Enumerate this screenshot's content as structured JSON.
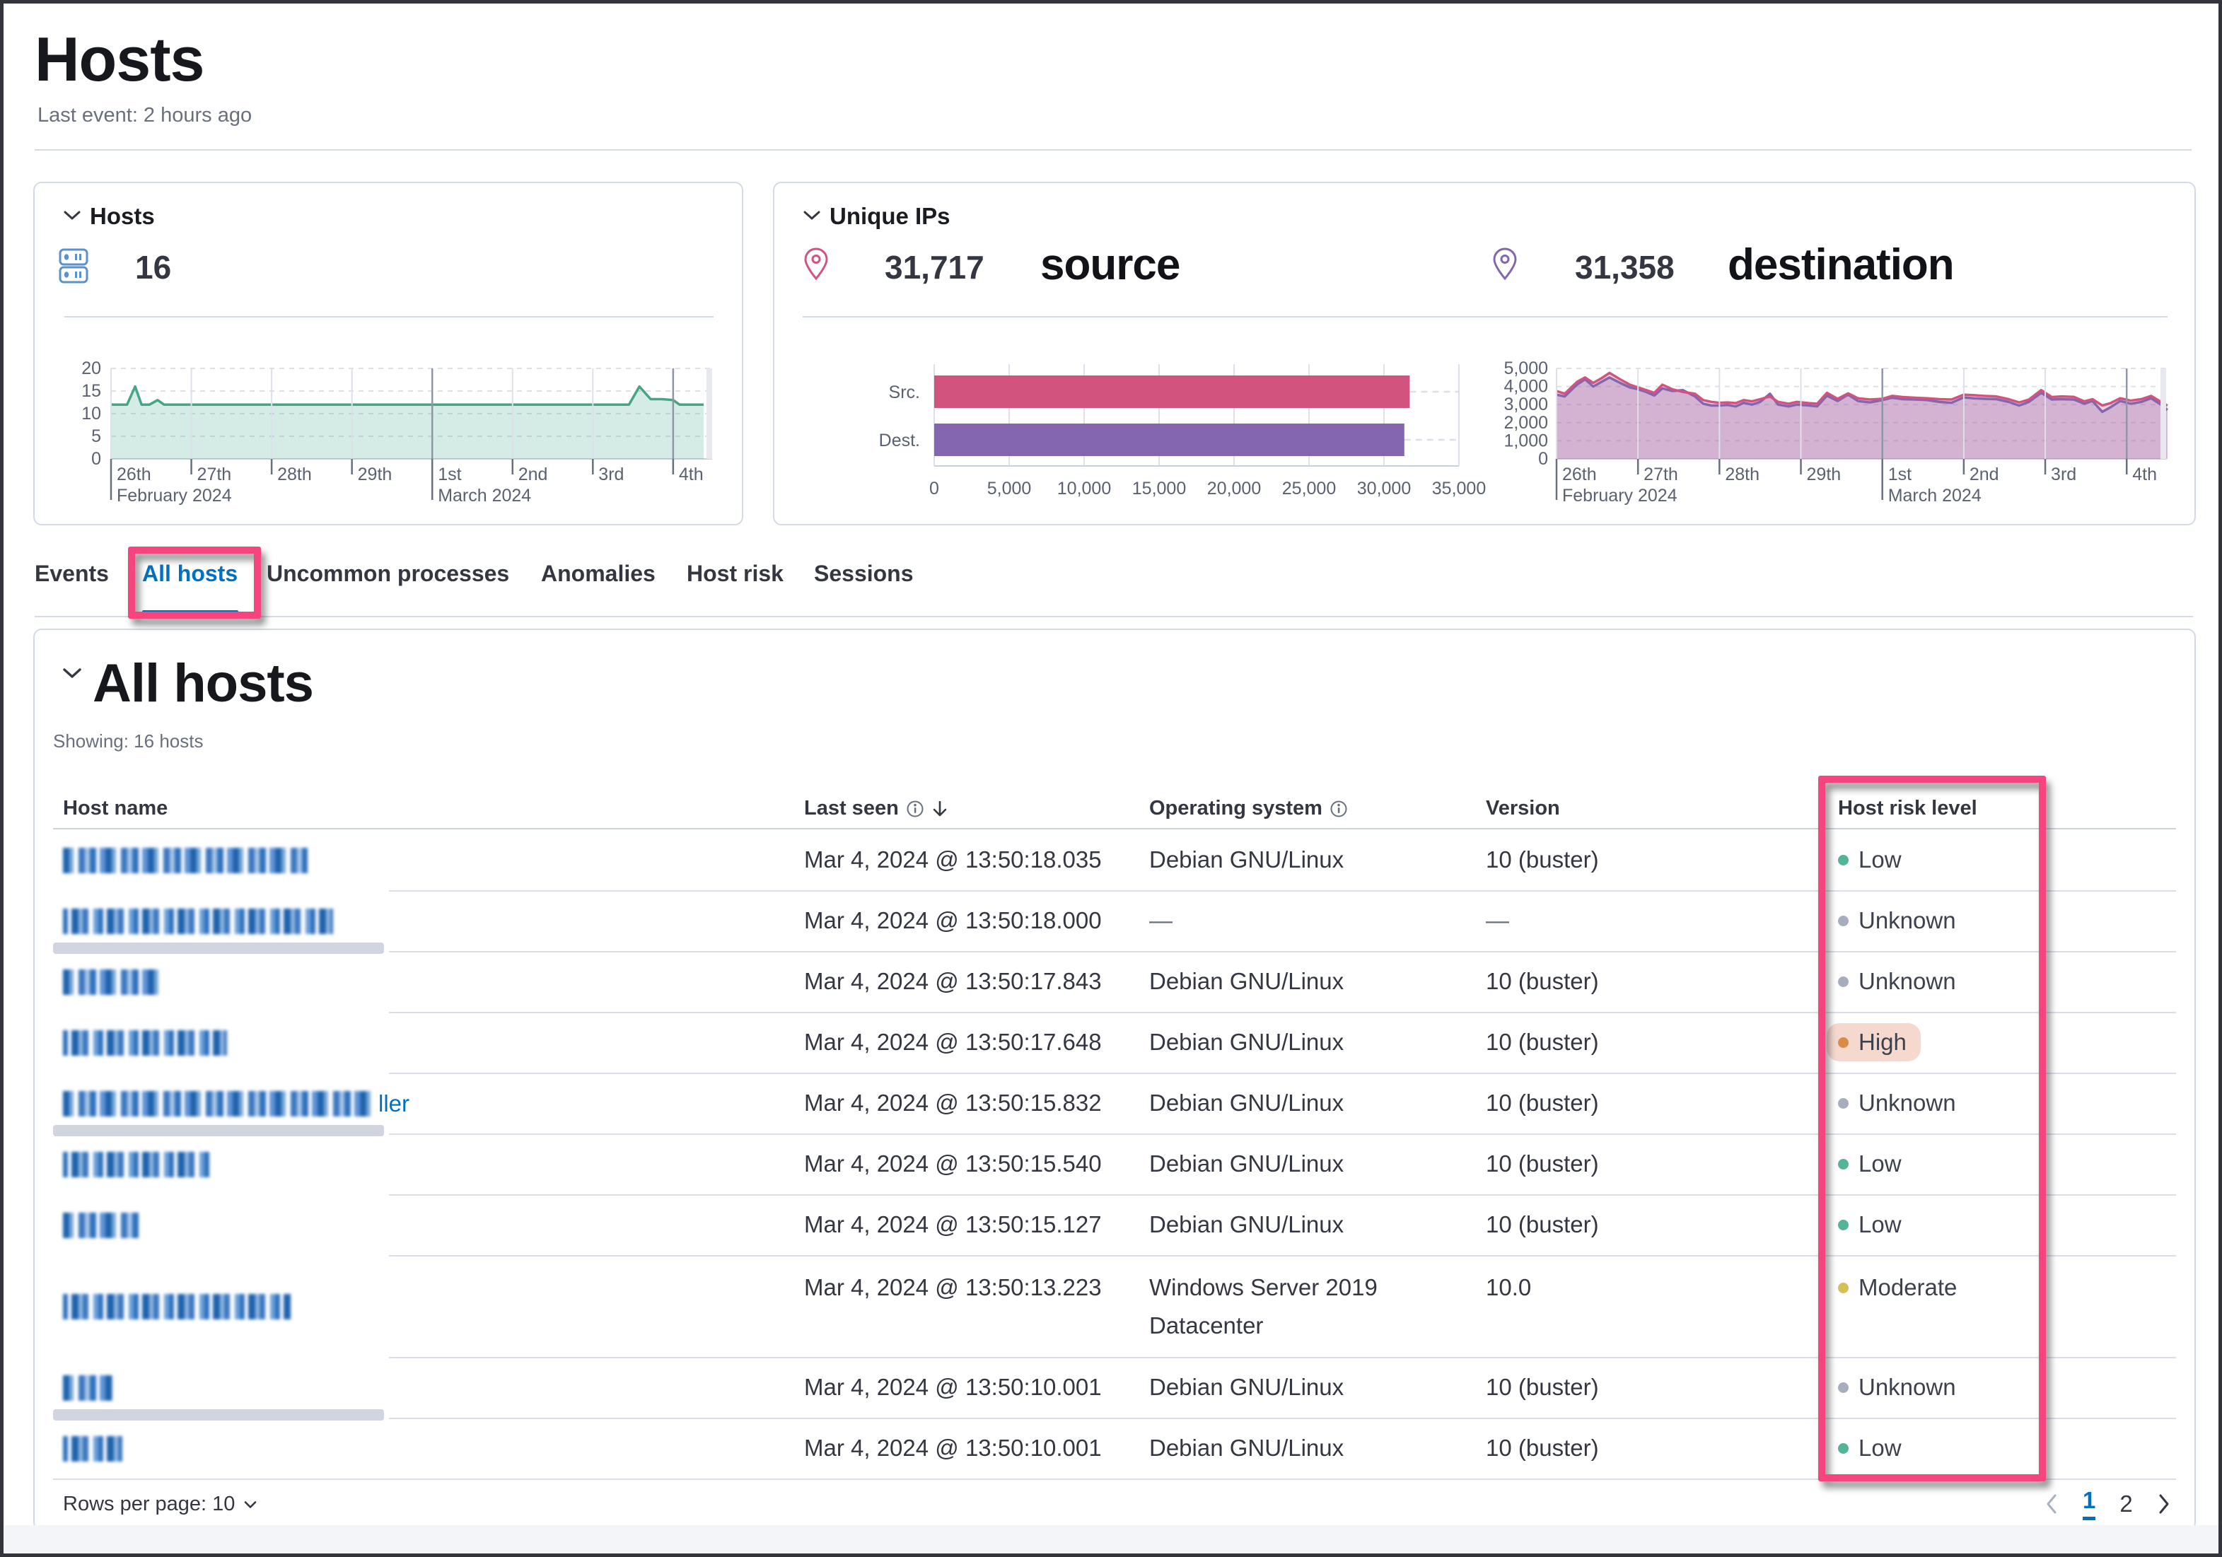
{
  "page": {
    "title": "Hosts",
    "last_event": "Last event: 2 hours ago"
  },
  "hosts_panel": {
    "title": "Hosts",
    "count": "16"
  },
  "unique_ips_panel": {
    "title": "Unique IPs",
    "source": {
      "value": "31,717",
      "label": "source"
    },
    "destination": {
      "value": "31,358",
      "label": "destination"
    },
    "bar_labels": {
      "src": "Src.",
      "dest": "Dest."
    }
  },
  "tabs": [
    {
      "label": "Events",
      "active": false
    },
    {
      "label": "All hosts",
      "active": true
    },
    {
      "label": "Uncommon processes",
      "active": false
    },
    {
      "label": "Anomalies",
      "active": false
    },
    {
      "label": "Host risk",
      "active": false
    },
    {
      "label": "Sessions",
      "active": false
    }
  ],
  "all_hosts": {
    "title": "All hosts",
    "showing": "Showing: 16 hosts",
    "columns": [
      {
        "label": "Host name",
        "info": false,
        "sorted": false
      },
      {
        "label": "Last seen",
        "info": true,
        "sorted": true
      },
      {
        "label": "Operating system",
        "info": true,
        "sorted": false
      },
      {
        "label": "Version",
        "info": false,
        "sorted": false
      },
      {
        "label": "Host risk level",
        "info": false,
        "sorted": false
      }
    ],
    "rows": [
      {
        "censor_width": 346,
        "name_suffix": "",
        "last_seen": "Mar 4, 2024 @ 13:50:18.035",
        "os": "Debian GNU/Linux",
        "os_line2": "",
        "version": "10 (buster)",
        "risk": "Low",
        "gray_bar": false
      },
      {
        "censor_width": 382,
        "name_suffix": "",
        "last_seen": "Mar 4, 2024 @ 13:50:18.000",
        "os": "—",
        "os_line2": "",
        "version": "—",
        "risk": "Unknown",
        "gray_bar": true
      },
      {
        "censor_width": 140,
        "name_suffix": "",
        "last_seen": "Mar 4, 2024 @ 13:50:17.843",
        "os": "Debian GNU/Linux",
        "os_line2": "",
        "version": "10 (buster)",
        "risk": "Unknown",
        "gray_bar": false
      },
      {
        "censor_width": 232,
        "name_suffix": "",
        "last_seen": "Mar 4, 2024 @ 13:50:17.648",
        "os": "Debian GNU/Linux",
        "os_line2": "",
        "version": "10 (buster)",
        "risk": "High",
        "gray_bar": false
      },
      {
        "censor_width": 442,
        "name_suffix": "ller",
        "last_seen": "Mar 4, 2024 @ 13:50:15.832",
        "os": "Debian GNU/Linux",
        "os_line2": "",
        "version": "10 (buster)",
        "risk": "Unknown",
        "gray_bar": true
      },
      {
        "censor_width": 208,
        "name_suffix": "",
        "last_seen": "Mar 4, 2024 @ 13:50:15.540",
        "os": "Debian GNU/Linux",
        "os_line2": "",
        "version": "10 (buster)",
        "risk": "Low",
        "gray_bar": false
      },
      {
        "censor_width": 108,
        "name_suffix": "",
        "last_seen": "Mar 4, 2024 @ 13:50:15.127",
        "os": "Debian GNU/Linux",
        "os_line2": "",
        "version": "10 (buster)",
        "risk": "Low",
        "gray_bar": false
      },
      {
        "censor_width": 322,
        "name_suffix": "",
        "last_seen": "Mar 4, 2024 @ 13:50:13.223",
        "os": "Windows Server 2019",
        "os_line2": "Datacenter",
        "version": "10.0",
        "risk": "Moderate",
        "gray_bar": false
      },
      {
        "censor_width": 70,
        "name_suffix": "",
        "last_seen": "Mar 4, 2024 @ 13:50:10.001",
        "os": "Debian GNU/Linux",
        "os_line2": "",
        "version": "10 (buster)",
        "risk": "Unknown",
        "gray_bar": true
      },
      {
        "censor_width": 84,
        "name_suffix": "",
        "last_seen": "Mar 4, 2024 @ 13:50:10.001",
        "os": "Debian GNU/Linux",
        "os_line2": "",
        "version": "10 (buster)",
        "risk": "Low",
        "gray_bar": false
      }
    ],
    "footer": {
      "rows_per_page": "Rows per page: 10",
      "pages": [
        "1",
        "2"
      ],
      "active_page": "1"
    }
  },
  "risk_styles": {
    "Low": {
      "dot": "#54b399",
      "bg": ""
    },
    "Unknown": {
      "dot": "#a6aebd",
      "bg": ""
    },
    "High": {
      "dot": "#da8b45",
      "bg": "#f6d9ce"
    },
    "Moderate": {
      "dot": "#d6bf57",
      "bg": ""
    }
  },
  "colors": {
    "accent_annotation": "#f5447e",
    "link_blue": "#0071c2",
    "green_line": "#45a584",
    "green_fill": "rgba(84,179,153,0.25)",
    "pink": "#d2537e",
    "purple": "#8465b0",
    "pink_fill": "rgba(211,96,134,0.28)",
    "purple_fill": "rgba(140,107,183,0.30)",
    "axis_text": "#5a6170",
    "grid_light": "#dde0e8",
    "grid_dark": "#8e96a8"
  },
  "chart_data": [
    {
      "name": "hosts_over_time",
      "type": "area",
      "ylabel": "hosts",
      "ylim": [
        0,
        20
      ],
      "yticks": [
        0,
        5,
        10,
        15,
        20
      ],
      "xticks": [
        "26th",
        "27th",
        "28th",
        "29th",
        "1st",
        "2nd",
        "3rd",
        "4th"
      ],
      "month_labels": [
        {
          "tick": 0,
          "label": "February 2024"
        },
        {
          "tick": 4,
          "label": "March 2024"
        }
      ],
      "series": [
        {
          "name": "hosts",
          "x": [
            0,
            0.2,
            0.3,
            0.38,
            0.48,
            0.58,
            0.66,
            0.76,
            1,
            1.5,
            2,
            2.5,
            3,
            3.5,
            4,
            4.5,
            5,
            5.5,
            6,
            6.45,
            6.58,
            6.72,
            6.86,
            7.0,
            7.08,
            7.38
          ],
          "y": [
            12,
            12,
            16,
            12,
            12,
            13,
            12,
            12,
            12,
            12,
            12,
            12,
            12,
            12,
            12,
            12,
            12,
            12,
            12,
            12,
            16,
            13.2,
            13.2,
            13,
            12,
            12
          ]
        }
      ]
    },
    {
      "name": "unique_ips_bars",
      "type": "bar",
      "categories": [
        "Src.",
        "Dest."
      ],
      "values": [
        31717,
        31358
      ],
      "bar_colors": [
        "#d2537e",
        "#8465b0"
      ],
      "xlim": [
        0,
        35000
      ],
      "xticks": [
        0,
        5000,
        10000,
        15000,
        20000,
        25000,
        30000,
        35000
      ]
    },
    {
      "name": "unique_ips_over_time",
      "type": "area",
      "ylim": [
        0,
        5000
      ],
      "yticks": [
        0,
        1000,
        2000,
        3000,
        4000,
        5000
      ],
      "xticks": [
        "26th",
        "27th",
        "28th",
        "29th",
        "1st",
        "2nd",
        "3rd",
        "4th"
      ],
      "month_labels": [
        {
          "tick": 0,
          "label": "February 2024"
        },
        {
          "tick": 4,
          "label": "March 2024"
        }
      ],
      "series": [
        {
          "name": "source",
          "color": "#d2537e",
          "x": [
            0,
            0.1,
            0.25,
            0.35,
            0.45,
            0.55,
            0.65,
            0.78,
            0.9,
            1.0,
            1.1,
            1.2,
            1.3,
            1.42,
            1.55,
            1.7,
            1.8,
            1.9,
            2.0,
            2.1,
            2.2,
            2.3,
            2.4,
            2.5,
            2.62,
            2.72,
            2.85,
            2.95,
            3.1,
            3.2,
            3.32,
            3.45,
            3.58,
            3.7,
            3.85,
            4.0,
            4.12,
            4.25,
            4.4,
            4.55,
            4.7,
            4.85,
            5.0,
            5.12,
            5.25,
            5.4,
            5.55,
            5.68,
            5.8,
            5.95,
            6.08,
            6.2,
            6.35,
            6.48,
            6.58,
            6.7,
            6.8,
            6.92,
            7.05,
            7.18,
            7.3,
            7.42,
            7.5
          ],
          "y": [
            3750,
            3600,
            4250,
            4500,
            4200,
            4450,
            4750,
            4400,
            4100,
            3950,
            3800,
            3650,
            4100,
            3850,
            3700,
            3600,
            3250,
            3150,
            3100,
            3120,
            3080,
            3250,
            3180,
            3300,
            3450,
            3150,
            3050,
            3150,
            3080,
            3050,
            3650,
            3320,
            3620,
            3350,
            3280,
            3320,
            3480,
            3420,
            3380,
            3350,
            3300,
            3280,
            3550,
            3520,
            3480,
            3450,
            3300,
            3120,
            3280,
            3800,
            3420,
            3450,
            3430,
            3180,
            3300,
            2950,
            3080,
            3350,
            3220,
            3300,
            3480,
            3150,
            2950
          ]
        },
        {
          "name": "destination",
          "color": "#8465b0",
          "x": [
            0,
            0.1,
            0.25,
            0.35,
            0.45,
            0.55,
            0.65,
            0.78,
            0.9,
            1.0,
            1.1,
            1.2,
            1.3,
            1.42,
            1.55,
            1.7,
            1.8,
            1.9,
            2.0,
            2.1,
            2.2,
            2.3,
            2.4,
            2.5,
            2.62,
            2.72,
            2.85,
            2.95,
            3.1,
            3.2,
            3.32,
            3.45,
            3.58,
            3.7,
            3.85,
            4.0,
            4.12,
            4.25,
            4.4,
            4.55,
            4.7,
            4.85,
            5.0,
            5.12,
            5.25,
            5.4,
            5.55,
            5.68,
            5.8,
            5.95,
            6.08,
            6.2,
            6.35,
            6.48,
            6.58,
            6.7,
            6.8,
            6.92,
            7.05,
            7.18,
            7.3,
            7.42,
            7.5
          ],
          "y": [
            3550,
            3450,
            4100,
            4400,
            4000,
            4250,
            4500,
            4200,
            3950,
            3850,
            3700,
            3500,
            3900,
            3750,
            3800,
            3450,
            3050,
            2950,
            2950,
            2980,
            2900,
            3100,
            3000,
            3150,
            3600,
            3000,
            2900,
            3000,
            2950,
            2900,
            3500,
            3200,
            3550,
            3200,
            3120,
            3250,
            3380,
            3300,
            3280,
            3250,
            3150,
            3100,
            3400,
            3350,
            3320,
            3300,
            3150,
            2950,
            3150,
            3650,
            3280,
            3300,
            3280,
            3050,
            3200,
            2600,
            2850,
            3200,
            3050,
            3150,
            3350,
            3000,
            2700
          ]
        }
      ]
    }
  ]
}
